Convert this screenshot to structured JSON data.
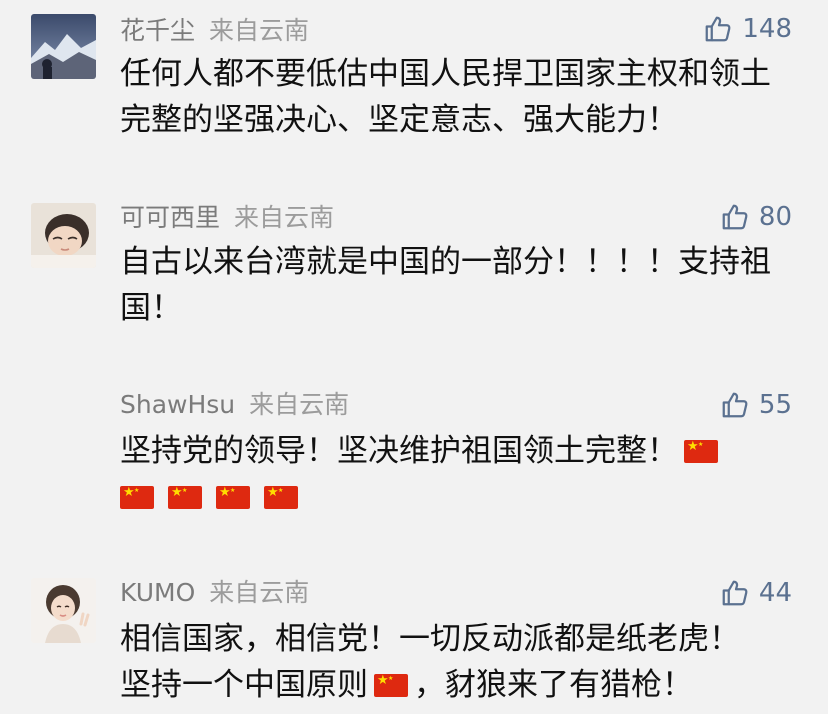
{
  "comments": [
    {
      "username": "花千尘",
      "location": "来自云南",
      "likes": "148",
      "text": "任何人都不要低估中国人民捍卫国家主权和领土完整的坚强决心、坚定意志、强大能力！"
    },
    {
      "username": "可可西里",
      "location": "来自云南",
      "likes": "80",
      "text": "自古以来台湾就是中国的一部分！！！！支持祖国！"
    },
    {
      "username": "ShawHsu",
      "location": "来自云南",
      "likes": "55",
      "text": "坚持党的领导！坚决维护祖国领土完整！"
    },
    {
      "username": "KUMO",
      "location": "来自云南",
      "likes": "44",
      "text_line1": "相信国家，相信党！一切反动派都是纸老虎！",
      "text_line2_a": "坚持一个中国原则",
      "text_line2_b": "，豺狼来了有猎枪！"
    }
  ],
  "colors": {
    "background": "#f2f2f2",
    "username": "#7b7b7b",
    "like": "#5b7190",
    "flag_red": "#de2910",
    "flag_star": "#ffde00"
  },
  "icons": {
    "like": "thumbs-up-icon",
    "flag": "china-flag-emoji"
  }
}
